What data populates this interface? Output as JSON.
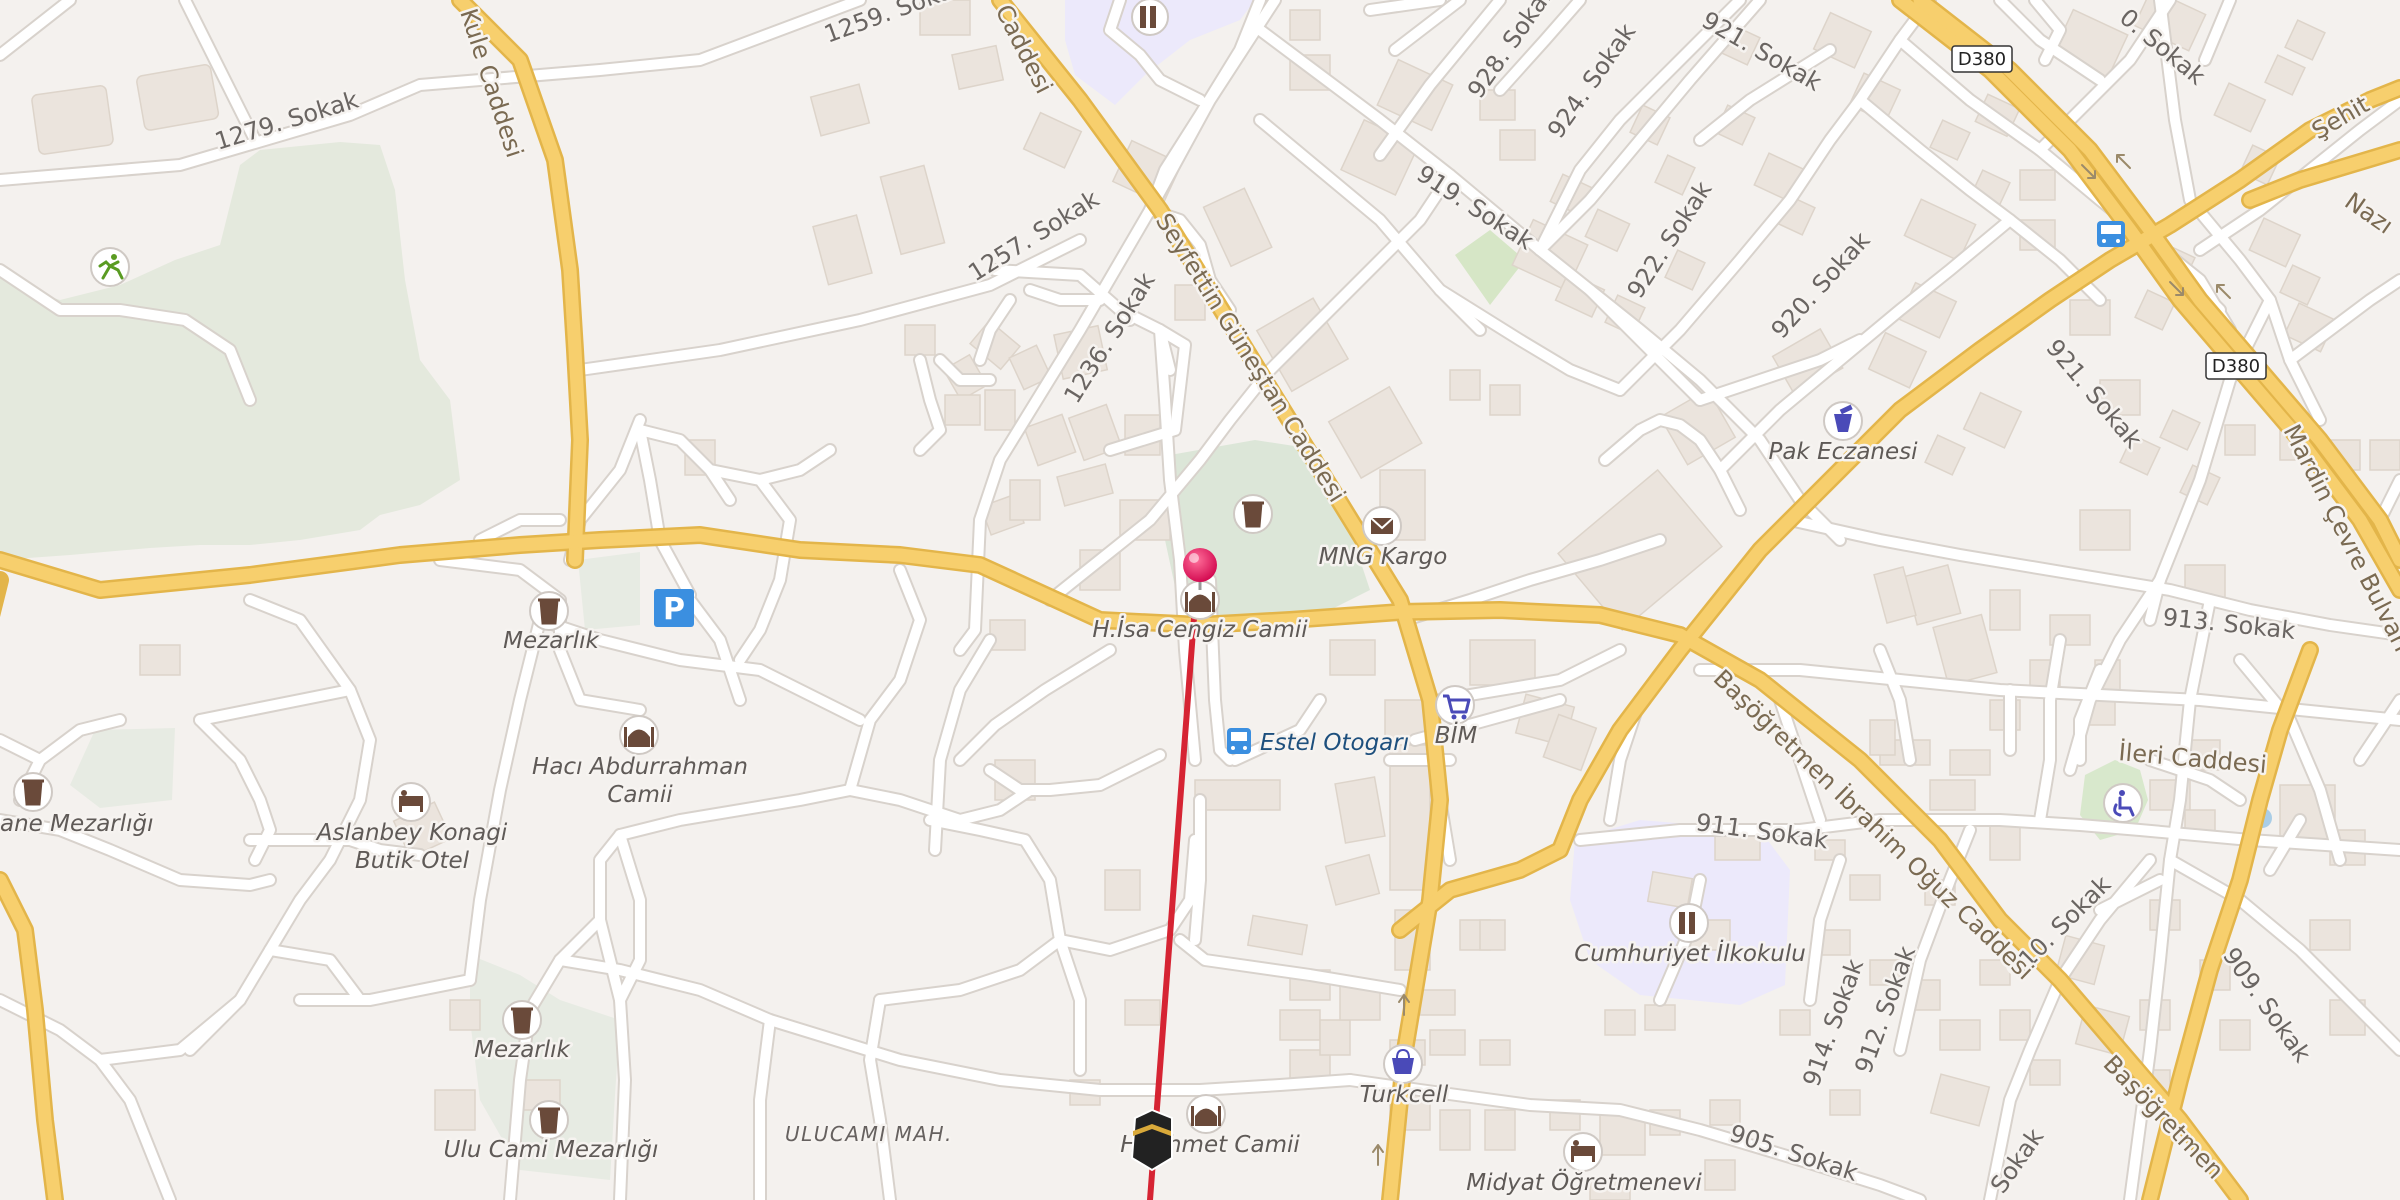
{
  "map": {
    "district": "ULUCAMI MAH.",
    "route_shields": [
      "D380",
      "D380"
    ],
    "colors": {
      "background": "#f4f1ee",
      "minor_road": "#ffffff",
      "major_road": "#f7cf6d",
      "major_road_casing": "#e3b54a",
      "building": "#ebe4dd",
      "green_area": "#e4e9dd",
      "school_area": "#ece9fb",
      "route_line": "#d62433",
      "pin": "#e8125c"
    },
    "streets": {
      "s1279": "1279. Sokak",
      "s1259": "1259. Sokak",
      "s1257": "1257. Sokak",
      "s1236": "1236. Sokak",
      "s928": "928. Sokak",
      "s924": "924. Sokak",
      "s921a": "921. Sokak",
      "s921b": "921. Sokak",
      "s919": "919. Sokak",
      "s922": "922. Sokak",
      "s920": "920. Sokak",
      "s913": "913. Sokak",
      "s911": "911. Sokak",
      "s910": "910. Sokak",
      "s909": "909. Sokak",
      "s914": "914. Sokak",
      "s912": "912. Sokak",
      "s905": "905. Sokak",
      "s_top": "0. Sokak",
      "s_bot": "Sokak",
      "kule": "Kule Caddesi",
      "caddesi_top": "Caddesi",
      "seyfettin": "Seyfettin Güneştan Caddesi",
      "basogretmen": "Başöğretmen İbrahim Oğuz Caddesi",
      "basogretmen2": "Başöğretmen",
      "ileri": "İleri Caddesi",
      "mardin": "Mardin Çevre Bulvarı",
      "sehit": "Şehit",
      "nazim": "Nazı"
    },
    "pois": {
      "mezarlik1": "Mezarlık",
      "haci_line1": "Hacı Abdurrahman",
      "haci_line2": "Camii",
      "aslanbey_line1": "Aslanbey Konagi",
      "aslanbey_line2": "Butik Otel",
      "ane_mezarligi": "ane Mezarlığı",
      "mezarlik2": "Mezarlık",
      "ulu_cami_mezarligi": "Ulu Cami Mezarlığı",
      "isa_cengiz": "H.İsa Cengiz Camii",
      "mng_kargo": "MNG Kargo",
      "estel_otogari": "Estel Otogarı",
      "bim": "BİM",
      "pak_eczanesi": "Pak Eczanesi",
      "cumhuriyet": "Cumhuriyet İlkokulu",
      "turkcell": "Turkcell",
      "midyat": "Midyat Öğretmenevi",
      "ahmet_camii": "Hı  Ahmet Camii"
    }
  }
}
